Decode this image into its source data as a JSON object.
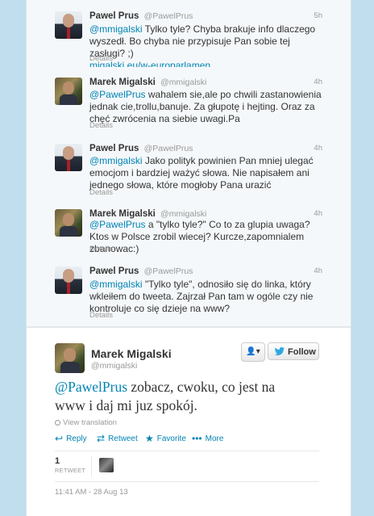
{
  "tweets": [
    {
      "name": "Pawel Prus",
      "handle": "@PawelPrus",
      "time": "5h",
      "mention": "@mmigalski",
      "text": " Tylko tyle? Chyba brakuje info dlaczego wyszedł. Bo chyba nie przypisuje Pan sobie tej zasługi? ;)",
      "link": "migalski.eu/w-europarlamen…",
      "details": "Details"
    },
    {
      "name": "Marek Migalski",
      "handle": "@mmigalski",
      "time": "4h",
      "mention": "@PawelPrus",
      "text": " wahalem sie,ale po chwili zastanowienia jednak cie,trollu,banuje. Za głupotę i hejting. Oraz za chęć zwrócenia na siebie uwagi.Pa",
      "details": "Details"
    },
    {
      "name": "Pawel Prus",
      "handle": "@PawelPrus",
      "time": "4h",
      "mention": "@mmigalski",
      "text": " Jako polityk powinien Pan mniej ulegać emocjom i bardziej ważyć słowa. Nie napisałem ani jednego słowa, które mogłoby Pana urazić",
      "details": "Details"
    },
    {
      "name": "Marek Migalski",
      "handle": "@mmigalski",
      "time": "4h",
      "mention": "@PawelPrus",
      "text": " a \"tylko tyle?\" Co to za glupia uwaga? Ktos w Polsce zrobil wiecej? Kurcze,zapomnialem zbanowac:)",
      "details": "Details"
    },
    {
      "name": "Pawel Prus",
      "handle": "@PawelPrus",
      "time": "4h",
      "mention": "@mmigalski",
      "text": " \"Tylko tyle\", odnosiło się do linka, który wkleiłem do tweeta. Zajrzał Pan tam w ogóle czy nie kontroluje co się dzieje na www?",
      "details": "Details"
    }
  ],
  "main_tweet": {
    "name": "Marek Migalski",
    "handle": "@mmigalski",
    "follow_label": "Follow",
    "user_menu_glyph": "👤▾",
    "mention": "@PawelPrus",
    "text": " zobacz, cwoku, co jest na www i daj mi juz spokój.",
    "view_translation": "View translation",
    "actions": {
      "reply": "Reply",
      "retweet": "Retweet",
      "favorite": "Favorite",
      "more": "More"
    },
    "retweet_count": "1",
    "retweet_label": "RETWEET",
    "timestamp": "11:41 AM - 28 Aug 13"
  },
  "colors": {
    "link": "#0084b4",
    "background": "#c0deed"
  }
}
